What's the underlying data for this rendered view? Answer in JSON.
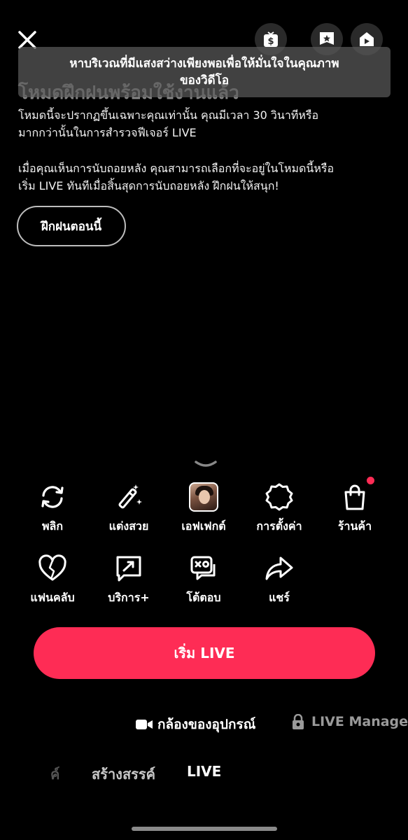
{
  "top_bar": {
    "close_icon": "close-icon",
    "buttons": [
      "coin-gift-icon",
      "star-badge-icon",
      "live-play-icon"
    ]
  },
  "toast": {
    "line1": "หาบริเวณที่มีแสงสว่างเพียงพอเพื่อให้มั่นใจในคุณภาพ",
    "line2": "ของวิดีโอ"
  },
  "practice_mode": {
    "title": "โหมดฝึกฝนพร้อมใช้งานแล้ว",
    "paragraph1_line1": "โหมดนี้จะปรากฏขึ้นเฉพาะคุณเท่านั้น คุณมีเวลา 30 วินาทีหรือ",
    "paragraph1_line2": "มากกว่านั้นในการสำรวจฟีเจอร์ LIVE",
    "paragraph2_line1": "เมื่อคุณเห็นการนับถอยหลัง คุณสามารถเลือกที่จะอยู่ในโหมดนี้หรือ",
    "paragraph2_line2": "เริ่ม LIVE ทันทีเมื่อสิ้นสุดการนับถอยหลัง ฝึกฝนให้สนุก!",
    "button_label": "ฝึกฝนตอนนี้"
  },
  "tools": {
    "row1": [
      {
        "label": "พลิก",
        "icon": "flip-camera-icon"
      },
      {
        "label": "แต่งสวย",
        "icon": "magic-wand-icon"
      },
      {
        "label": "เอฟเฟกต์",
        "icon": "effect-avatar"
      },
      {
        "label": "การตั้งค่า",
        "icon": "settings-icon"
      },
      {
        "label": "ร้านค้า",
        "icon": "shopping-bag-icon"
      }
    ],
    "row2": [
      {
        "label": "แฟนคลับ",
        "icon": "heart-icon"
      },
      {
        "label": "บริการ+",
        "icon": "service-plus-icon"
      },
      {
        "label": "โต้ตอบ",
        "icon": "interact-icon"
      },
      {
        "label": "แชร์",
        "icon": "share-icon"
      }
    ]
  },
  "start_live_label": "เริ่ม LIVE",
  "source": {
    "device_camera": "กล้องของอุปกรณ์",
    "live_manager": "LIVE Manage"
  },
  "mode_tabs": {
    "left_partial": "ค์",
    "create": "สร้างสรรค์",
    "live": "LIVE"
  },
  "colors": {
    "accent": "#fe2c55",
    "background": "#000000"
  }
}
